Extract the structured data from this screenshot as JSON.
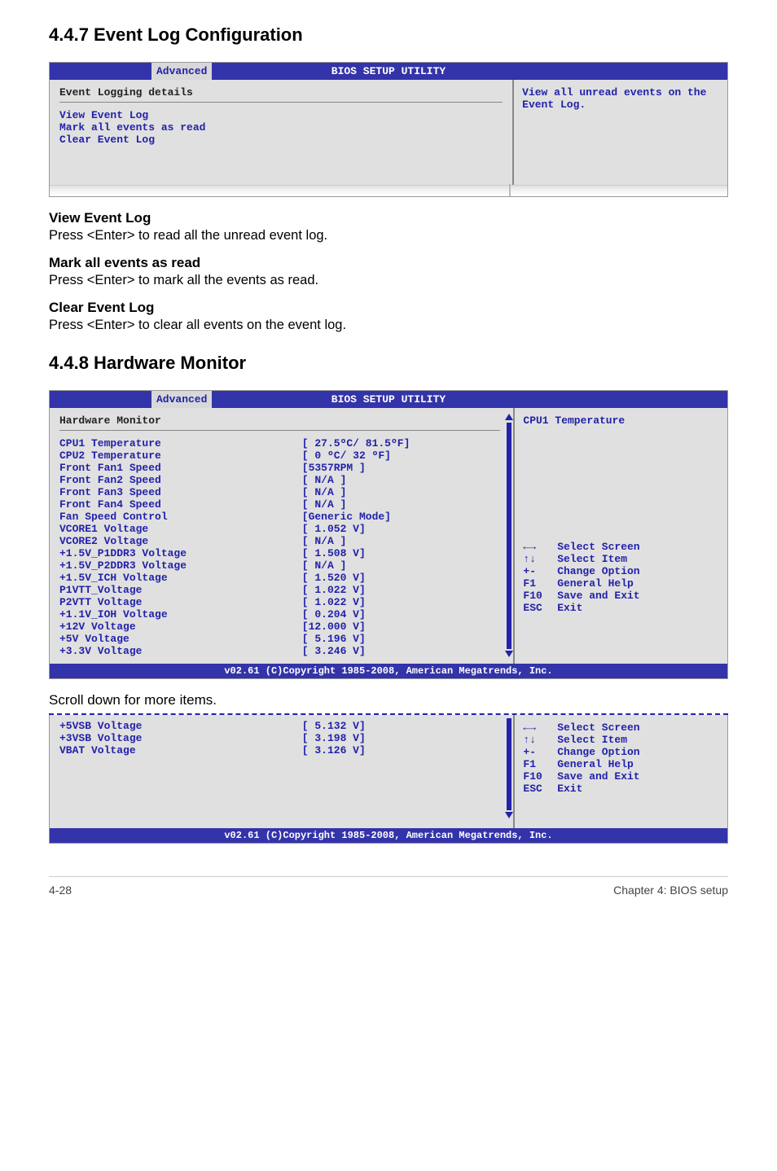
{
  "section_447": {
    "title": "4.4.7    Event Log Configuration"
  },
  "bios1": {
    "titlebar": "BIOS SETUP UTILITY",
    "tab": "Advanced",
    "heading": "Event Logging details",
    "items": [
      "View Event Log",
      "Mark all events as read",
      "Clear Event Log"
    ],
    "help": "View all unread events on the Event Log."
  },
  "view_event_log": {
    "h": "View Event Log",
    "p": "Press <Enter> to read all the unread event log."
  },
  "mark_all": {
    "h": "Mark all events as read",
    "p": "Press <Enter> to mark all the events as read."
  },
  "clear_log": {
    "h": "Clear Event Log",
    "p": "Press <Enter> to clear all events on the event log."
  },
  "section_448": {
    "title": "4.4.8    Hardware Monitor"
  },
  "bios2": {
    "titlebar": "BIOS SETUP UTILITY",
    "tab": "Advanced",
    "heading": "Hardware Monitor",
    "rows": [
      {
        "label": "CPU1 Temperature",
        "value": "[ 27.5ºC/ 81.5ºF]"
      },
      {
        "label": "CPU2 Temperature",
        "value": "[ 0   ºC/ 32  ºF]"
      },
      {
        "label": "Front Fan1 Speed",
        "value": "[5357RPM ]"
      },
      {
        "label": "Front Fan2 Speed",
        "value": "[  N/A   ]"
      },
      {
        "label": "Front Fan3 Speed",
        "value": "[  N/A   ]"
      },
      {
        "label": "Front Fan4 Speed",
        "value": "[  N/A   ]"
      },
      {
        "label": "Fan Speed Control",
        "value": "[Generic Mode]"
      },
      {
        "label": "VCORE1 Voltage",
        "value": "[ 1.052 V]"
      },
      {
        "label": "VCORE2 Voltage",
        "value": "[  N/A  ]"
      },
      {
        "label": "+1.5V_P1DDR3 Voltage",
        "value": "[ 1.508 V]"
      },
      {
        "label": "+1.5V_P2DDR3 Voltage",
        "value": "[  N/A  ]"
      },
      {
        "label": "+1.5V_ICH Voltage",
        "value": "[ 1.520 V]"
      },
      {
        "label": "P1VTT_Voltage",
        "value": "[ 1.022 V]"
      },
      {
        "label": "P2VTT Voltage",
        "value": "[ 1.022 V]"
      },
      {
        "label": "+1.1V_IOH Voltage",
        "value": "[ 0.204 V]"
      },
      {
        "label": "+12V Voltage",
        "value": "[12.000 V]"
      },
      {
        "label": "+5V Voltage",
        "value": "[ 5.196 V]"
      },
      {
        "label": "+3.3V Voltage",
        "value": "[ 3.246 V]"
      }
    ],
    "right_heading": "CPU1 Temperature",
    "help_keys": [
      {
        "sym": "←→",
        "label": "Select Screen"
      },
      {
        "sym": "↑↓",
        "label": "Select Item"
      },
      {
        "sym": "+-",
        "label": "Change Option"
      },
      {
        "sym": "F1",
        "label": "General Help"
      },
      {
        "sym": "F10",
        "label": "Save and Exit"
      },
      {
        "sym": "ESC",
        "label": "Exit"
      }
    ],
    "footer": "v02.61 (C)Copyright 1985-2008, American Megatrends, Inc."
  },
  "scroll_note": "Scroll down for more items.",
  "bios3": {
    "rows": [
      {
        "label": "+5VSB Voltage",
        "value": "[ 5.132 V]"
      },
      {
        "label": "+3VSB Voltage",
        "value": "[ 3.198 V]"
      },
      {
        "label": "VBAT Voltage",
        "value": "[ 3.126 V]"
      }
    ],
    "help_keys": [
      {
        "sym": "←→",
        "label": "Select Screen"
      },
      {
        "sym": "↑↓",
        "label": "Select Item"
      },
      {
        "sym": "+-",
        "label": "Change Option"
      },
      {
        "sym": "F1",
        "label": "General Help"
      },
      {
        "sym": "F10",
        "label": "Save and Exit"
      },
      {
        "sym": "ESC",
        "label": "Exit"
      }
    ],
    "footer": "v02.61 (C)Copyright 1985-2008, American Megatrends, Inc."
  },
  "page_footer": {
    "left": "4-28",
    "right": "Chapter 4: BIOS setup"
  }
}
